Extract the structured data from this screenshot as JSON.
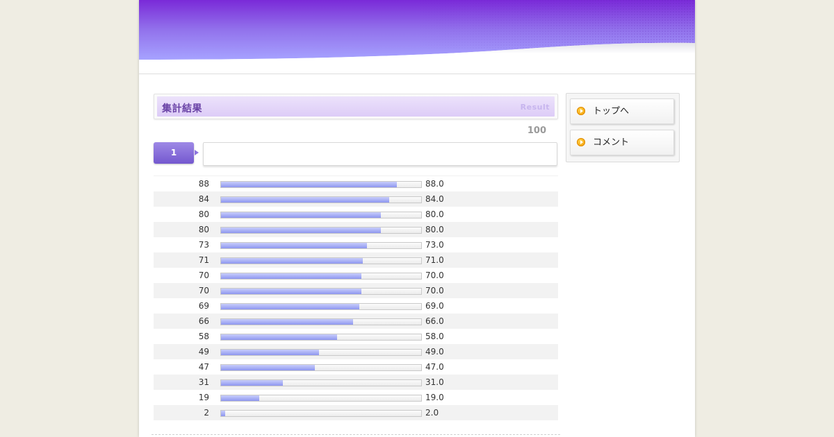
{
  "section": {
    "title": "集計結果",
    "subtitle": "Result",
    "total": "100"
  },
  "question": {
    "number": "1",
    "text": ""
  },
  "chart_data": {
    "type": "bar",
    "orientation": "horizontal",
    "title": "",
    "xlim": [
      0,
      100
    ],
    "categories": [
      "88",
      "84",
      "80",
      "80",
      "73",
      "71",
      "70",
      "70",
      "69",
      "66",
      "58",
      "49",
      "47",
      "31",
      "19",
      "2"
    ],
    "values": [
      88.0,
      84.0,
      80.0,
      80.0,
      73.0,
      71.0,
      70.0,
      70.0,
      69.0,
      66.0,
      58.0,
      49.0,
      47.0,
      31.0,
      19.0,
      2.0
    ],
    "value_labels": [
      "88.0",
      "84.0",
      "80.0",
      "80.0",
      "73.0",
      "71.0",
      "70.0",
      "70.0",
      "69.0",
      "66.0",
      "58.0",
      "49.0",
      "47.0",
      "31.0",
      "19.0",
      "2.0"
    ]
  },
  "sidebar": {
    "items": [
      {
        "label": "トップへ",
        "icon": "arrow-right-icon"
      },
      {
        "label": "コメント",
        "icon": "arrow-right-icon"
      }
    ]
  },
  "colors": {
    "header_purple": "#8a6ee0",
    "bar_fill": "#9aa2f2",
    "badge": "#7f66d6",
    "accent_orange": "#f5a300"
  }
}
